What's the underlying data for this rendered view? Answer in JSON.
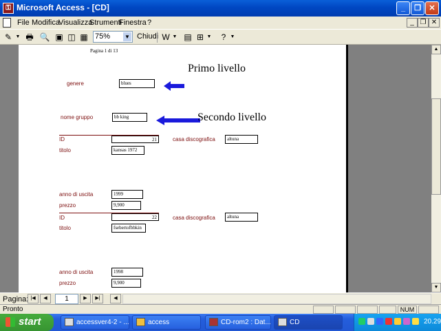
{
  "window": {
    "title": "Microsoft Access - [CD]",
    "app_icon": "access-key-icon"
  },
  "menu": {
    "items": [
      "File",
      "Modifica",
      "Visualizza",
      "Strumenti",
      "Finestra",
      "?"
    ]
  },
  "toolbar": {
    "zoom_value": "75%",
    "close_label": "Chiudi"
  },
  "report": {
    "page_info": "Pagina 1 di 13",
    "annotation_primo": "Primo livello",
    "annotation_secondo": "Secondo livello",
    "genere_label": "genere",
    "genere_value": "blues",
    "gruppo_label": "nome gruppo",
    "gruppo_value": "bb king",
    "records": [
      {
        "id_label": "ID",
        "id_value": "21",
        "casa_label": "casa discografica",
        "casa_value": "altuna",
        "titolo_label": "titolo",
        "titolo_value": "kansas 1972",
        "anno_label": "anno di uscita",
        "anno_value": "1999",
        "prezzo_label": "prezzo",
        "prezzo_value": "9,900"
      },
      {
        "id_label": "ID",
        "id_value": "22",
        "casa_label": "casa discografica",
        "casa_value": "altuna",
        "titolo_label": "titolo",
        "titolo_value": "fsebertofbbkin",
        "anno_label": "anno di uscita",
        "anno_value": "1998",
        "prezzo_label": "prezzo",
        "prezzo_value": "9,900"
      }
    ]
  },
  "navigation": {
    "label": "Pagina:",
    "current_page": "1"
  },
  "status": {
    "text": "Pronto",
    "num_indicator": "NUM"
  },
  "taskbar": {
    "start_label": "start",
    "tasks": [
      "accessver4-2 - ...",
      "access",
      "CD-rom2 : Dat...",
      "CD"
    ],
    "clock": "20.29"
  },
  "colors": {
    "field_label": "#7b0c0c",
    "arrow": "#1a1adc",
    "title_bar": "#0a5fd8"
  }
}
